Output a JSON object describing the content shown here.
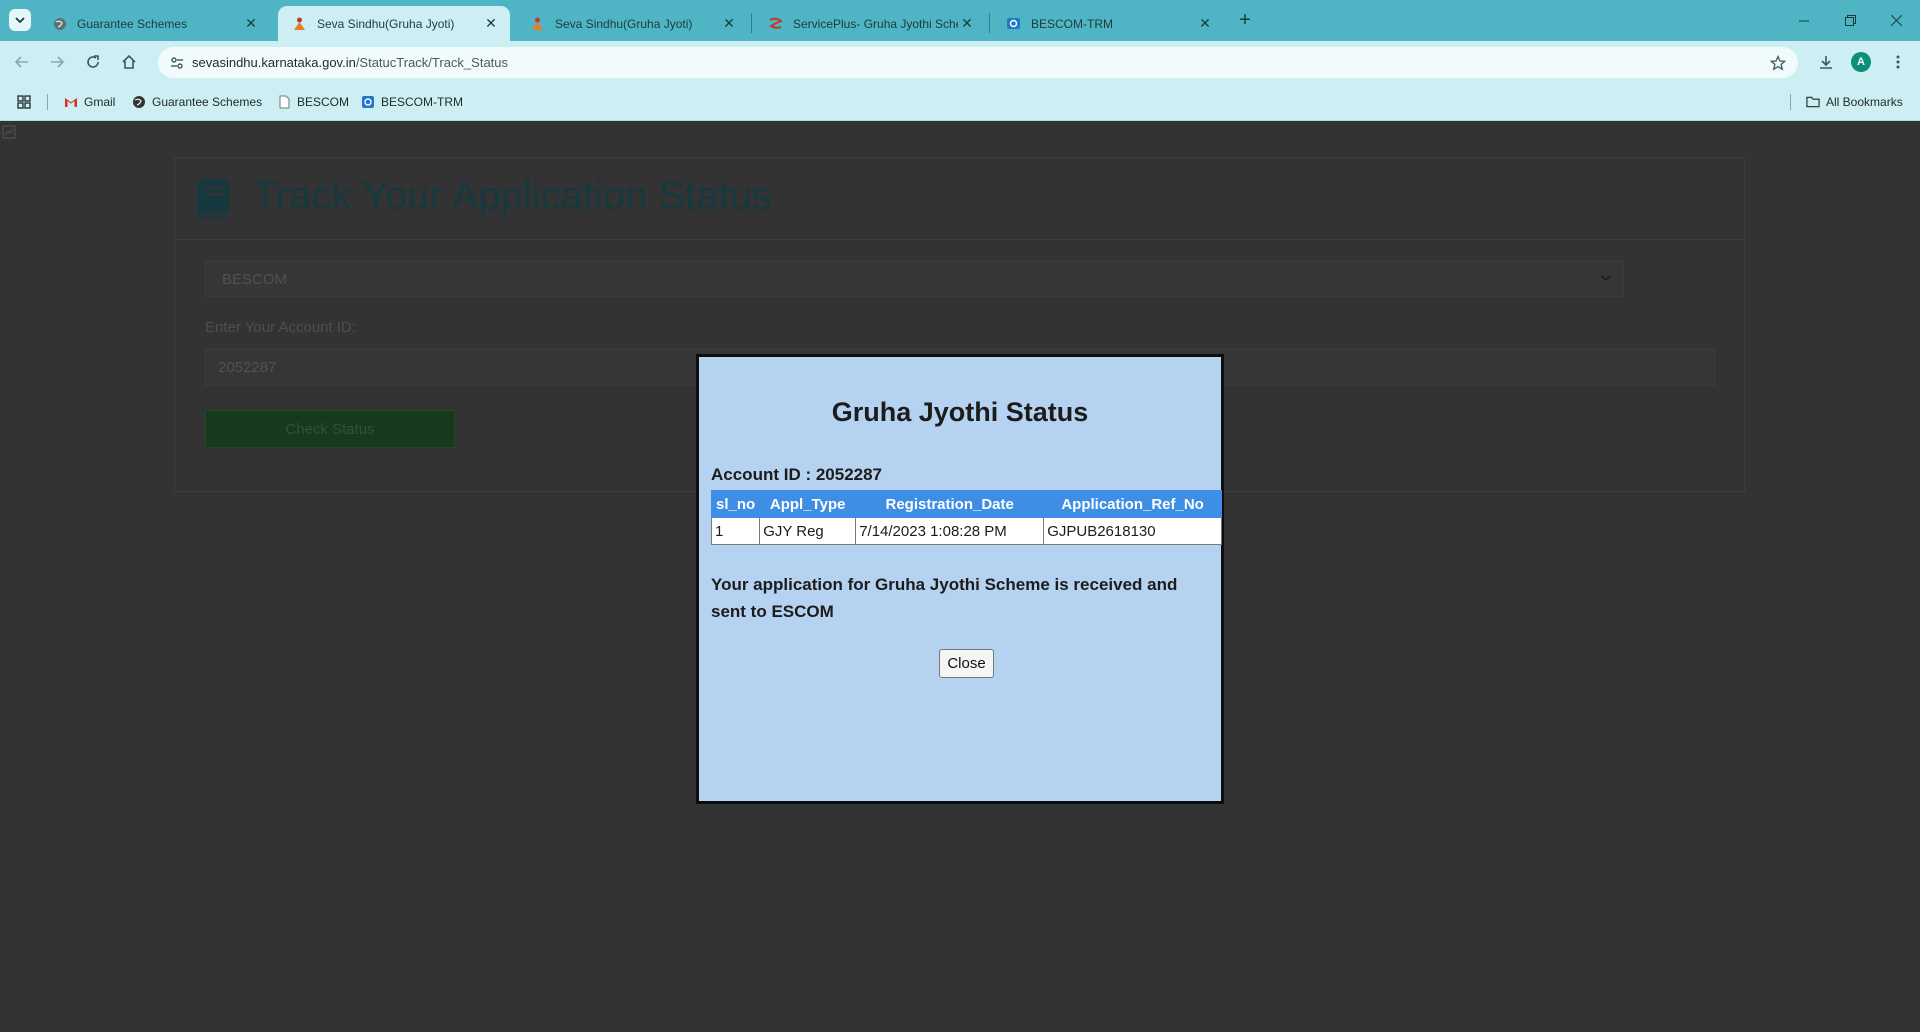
{
  "browser": {
    "tabs": [
      {
        "title": "Guarantee Schemes",
        "icon": "globe-icon",
        "active": false
      },
      {
        "title": "Seva Sindhu(Gruha Jyoti)",
        "icon": "seva-sindhu-icon",
        "active": true
      },
      {
        "title": "Seva Sindhu(Gruha Jyoti)",
        "icon": "seva-sindhu-icon",
        "active": false
      },
      {
        "title": "ServicePlus- Gruha Jyothi Sche",
        "icon": "serviceplus-icon",
        "active": false
      },
      {
        "title": "BESCOM-TRM",
        "icon": "bescom-trm-icon",
        "active": false
      }
    ],
    "address": {
      "domain": "sevasindhu.karnataka.gov.in",
      "path": "/StatucTrack/Track_Status"
    },
    "profile_initial": "A",
    "bookmarks": [
      {
        "label": "Gmail",
        "icon": "gmail-icon"
      },
      {
        "label": "Guarantee Schemes",
        "icon": "globe-icon"
      },
      {
        "label": "BESCOM",
        "icon": "page-icon"
      },
      {
        "label": "BESCOM-TRM",
        "icon": "bescom-trm-icon"
      }
    ],
    "all_bookmarks": "All Bookmarks"
  },
  "page": {
    "title": "Track Your Application Status",
    "escom_select": "BESCOM",
    "account_label": "Enter Your Account ID:",
    "account_value": "2052287",
    "check_button": "Check Status"
  },
  "modal": {
    "title": "Gruha Jyothi Status",
    "account_line": "Account ID : 2052287",
    "columns": [
      "sl_no",
      "Appl_Type",
      "Registration_Date",
      "Application_Ref_No"
    ],
    "rows": [
      [
        "1",
        "GJY Reg",
        "7/14/2023 1:08:28 PM",
        "GJPUB2618130"
      ]
    ],
    "message": "Your application for Gruha Jyothi Scheme is received and sent to ESCOM",
    "close_label": "Close"
  },
  "colors": {
    "tab_strip": "#4fb5c4",
    "toolbar": "#cdeef2",
    "overlay_page": "#333333",
    "modal_bg": "#b5d2f0",
    "table_header": "#3f8ee5",
    "heading_teal": "#16393f"
  }
}
